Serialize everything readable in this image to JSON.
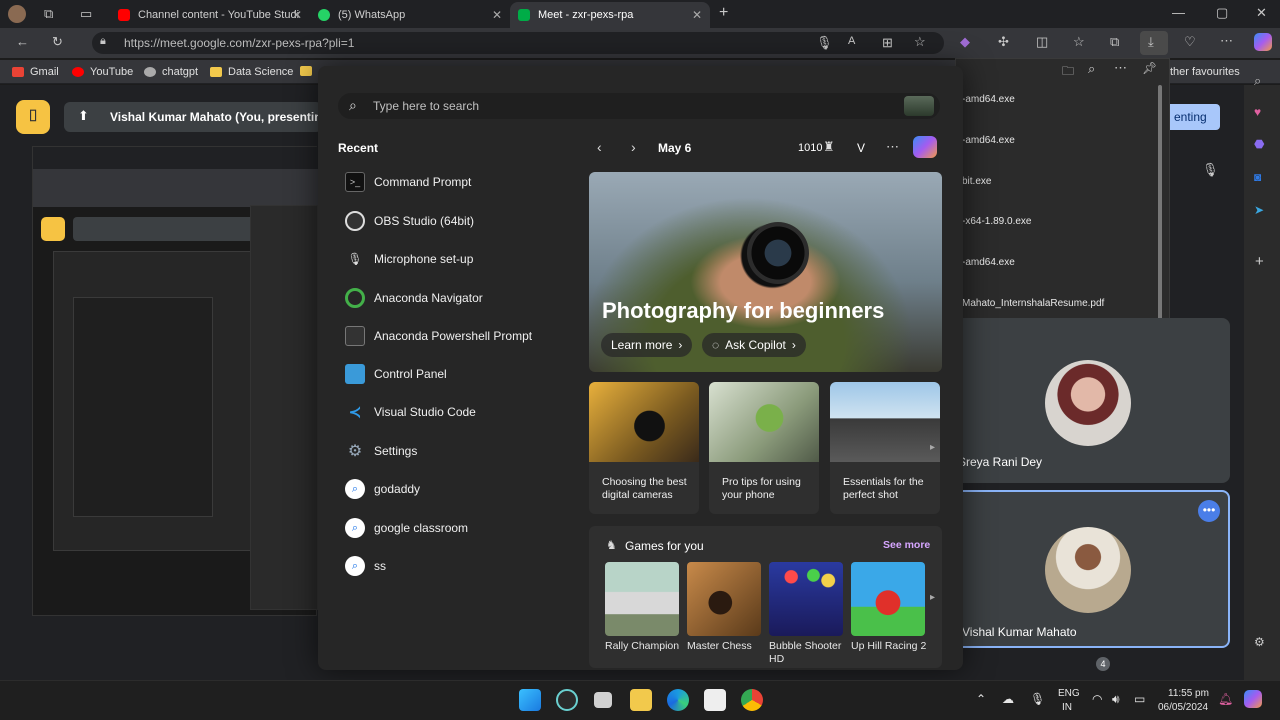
{
  "browser": {
    "tabs": [
      {
        "label": "Channel content - YouTube Studi",
        "color": "#ff0000"
      },
      {
        "label": "(5) WhatsApp",
        "color": "#25d366"
      },
      {
        "label": "Meet - zxr-pexs-rpa",
        "color": "#e84a3f"
      }
    ],
    "url": "https://meet.google.com/zxr-pexs-rpa?pli=1",
    "bookmarks": [
      "Gmail",
      "YouTube",
      "chatgpt",
      "Data Science"
    ],
    "other_favourites": "ther favourites"
  },
  "meet": {
    "presenter_banner": "Vishal Kumar Mahato (You, presenting",
    "present_button": "enting",
    "participants": [
      {
        "name": "Sreya Rani Dey"
      },
      {
        "name": "Vishal Kumar Mahato"
      }
    ],
    "people_count": "4"
  },
  "downloads": [
    "-amd64.exe",
    "-amd64.exe",
    "bit.exe",
    "-x64-1.89.0.exe",
    "-amd64.exe",
    "Mahato_InternshalaResume.pdf"
  ],
  "start_menu": {
    "search_placeholder": "Type here to search",
    "recent_heading": "Recent",
    "recent": [
      {
        "label": "Command Prompt",
        "icon": "cmd-icon"
      },
      {
        "label": "OBS Studio (64bit)",
        "icon": "obs-icon"
      },
      {
        "label": "Microphone set-up",
        "icon": "microphone-icon"
      },
      {
        "label": "Anaconda Navigator",
        "icon": "anaconda-icon"
      },
      {
        "label": "Anaconda Powershell Prompt",
        "icon": "powershell-icon"
      },
      {
        "label": "Control Panel",
        "icon": "control-panel-icon"
      },
      {
        "label": "Visual Studio Code",
        "icon": "vscode-icon"
      },
      {
        "label": "Settings",
        "icon": "gear-icon"
      },
      {
        "label": "godaddy",
        "icon": "search-icon"
      },
      {
        "label": "google classroom",
        "icon": "search-icon"
      },
      {
        "label": "ss",
        "icon": "search-icon"
      }
    ],
    "date": "May 6",
    "points": "1010",
    "avatar_letter": "V",
    "hero_title": "Photography for beginners",
    "learn_more": "Learn more",
    "ask_copilot": "Ask Copilot",
    "cards": [
      {
        "caption": "Choosing the best digital cameras"
      },
      {
        "caption": "Pro tips for using your phone"
      },
      {
        "caption": "Essentials for the perfect shot"
      }
    ],
    "games_heading": "Games for you",
    "see_more": "See more",
    "games": [
      {
        "label": "Rally Champion"
      },
      {
        "label": "Master Chess"
      },
      {
        "label": "Bubble Shooter HD"
      },
      {
        "label": "Up Hill Racing 2"
      }
    ]
  },
  "taskbar": {
    "lang": "ENG",
    "region": "IN",
    "time": "11:55 pm",
    "date": "06/05/2024"
  }
}
